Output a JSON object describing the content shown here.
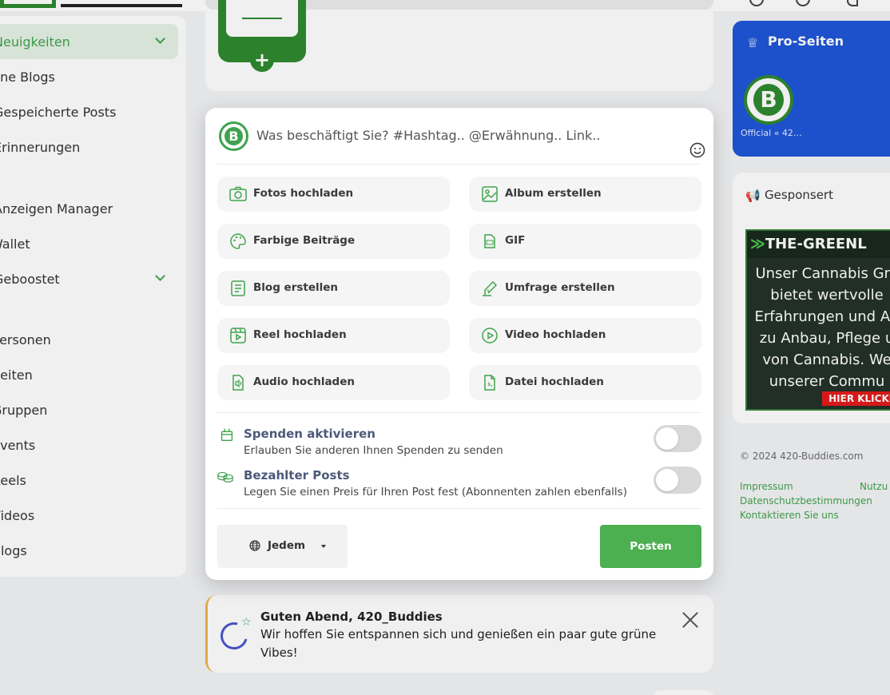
{
  "sidebar": {
    "items": [
      {
        "label": "Neuigkeiten",
        "active": true,
        "chevron": true
      },
      {
        "label": "Meine Blogs"
      },
      {
        "label": "Gespeicherte Posts"
      },
      {
        "label": "Erinnerungen"
      },
      {
        "label": "Anzeigen Manager"
      },
      {
        "label": "Wallet"
      },
      {
        "label": "Geboostet",
        "chevron": true
      },
      {
        "label": "Personen"
      },
      {
        "label": "Seiten"
      },
      {
        "label": "Gruppen"
      },
      {
        "label": "Events"
      },
      {
        "label": "Reels"
      },
      {
        "label": "Videos"
      },
      {
        "label": "Blogs"
      }
    ]
  },
  "pro_pages": {
    "title": "Pro-Seiten",
    "item_label": "Official « 42…"
  },
  "sponsored": {
    "title": "Gesponsert",
    "ad_headline": "THE-GREENL",
    "ad_lines": [
      "Unser Cannabis Gro",
      "bietet wertvolle",
      "Erfahrungen und Au",
      "zu Anbau, Pflege u",
      "von Cannabis. We",
      "unserer Commu"
    ],
    "ad_button": "HIER KLICKEN"
  },
  "footer": {
    "copyright": "© 2024 420-Buddies.com",
    "links": [
      "Impressum",
      "Nutzu",
      "Datenschutzbestimmungen",
      "Kontaktieren Sie uns"
    ]
  },
  "greeting": {
    "title": "Guten Abend, 420_Buddies",
    "text": "Wir hoffen Sie entspannen sich und genießen ein paar gute grüne Vibes!"
  },
  "composer": {
    "avatar_letter": "B",
    "placeholder": "Was beschäftigt Sie? #Hashtag.. @Erwähnung.. Link..",
    "options": [
      {
        "label": "Fotos hochladen",
        "icon": "camera-icon"
      },
      {
        "label": "Album erstellen",
        "icon": "album-icon"
      },
      {
        "label": "Farbige Beiträge",
        "icon": "palette-icon"
      },
      {
        "label": "GIF",
        "icon": "gif-icon"
      },
      {
        "label": "Blog erstellen",
        "icon": "blog-icon"
      },
      {
        "label": "Umfrage erstellen",
        "icon": "poll-icon"
      },
      {
        "label": "Reel hochladen",
        "icon": "reel-icon"
      },
      {
        "label": "Video hochladen",
        "icon": "video-icon"
      },
      {
        "label": "Audio hochladen",
        "icon": "audio-icon"
      },
      {
        "label": "Datei hochladen",
        "icon": "file-icon"
      }
    ],
    "donations": {
      "title": "Spenden aktivieren",
      "desc": "Erlauben Sie anderen Ihnen Spenden zu senden",
      "enabled": false
    },
    "paid_posts": {
      "title": "Bezahlter Posts",
      "desc": "Legen Sie einen Preis für Ihren Post fest (Abonnenten zahlen ebenfalls)",
      "enabled": false
    },
    "audience_label": "Jedem",
    "post_label": "Posten"
  },
  "colors": {
    "accent_green": "#4caf50",
    "pro_blue": "#1f55d8",
    "label_blue": "#4c5a7a"
  }
}
